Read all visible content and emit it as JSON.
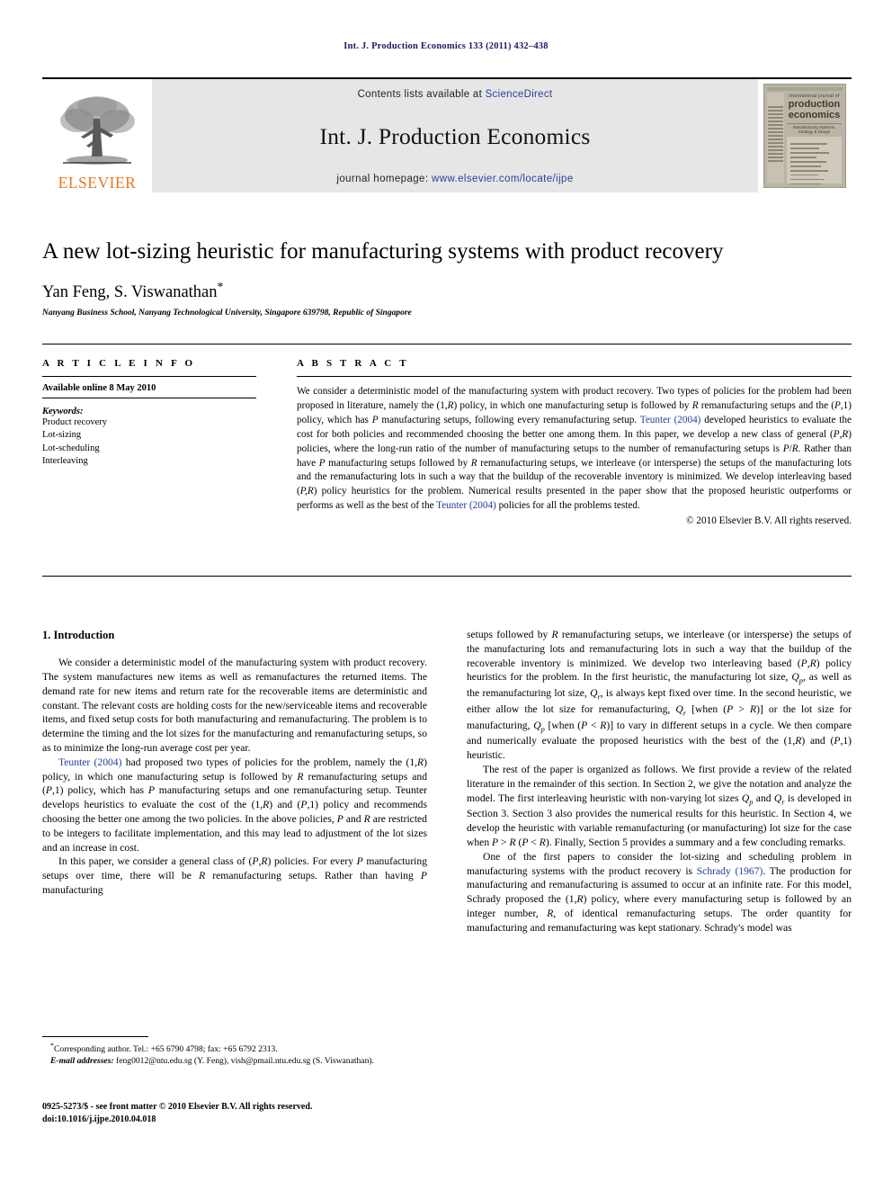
{
  "running_head": "Int. J. Production Economics 133 (2011) 432–438",
  "masthead": {
    "contents_prefix": "Contents lists available at ",
    "sciencedirect": "ScienceDirect",
    "journal_title": "Int. J. Production Economics",
    "homepage_prefix": "journal homepage: ",
    "homepage_url": "www.elsevier.com/locate/ijpe",
    "publisher_logo_text": "ELSEVIER",
    "cover": {
      "line1": "international journal of",
      "line2": "production",
      "line3": "economics",
      "line4": "Manufacturing Systems, Strategy & Design"
    },
    "colors": {
      "elsevier_orange": "#E87722",
      "link_blue": "#2b3f9c",
      "band_grey": "#e6e6e6"
    }
  },
  "article": {
    "title": "A new lot-sizing heuristic for manufacturing systems with product recovery",
    "authors": "Yan Feng, S. Viswanathan",
    "corresponding_marker": "*",
    "affiliation": "Nanyang Business School, Nanyang Technological University, Singapore 639798, Republic of Singapore"
  },
  "article_info": {
    "heading": "A R T I C L E   I N F O",
    "available_online": "Available online 8 May 2010",
    "keywords_label": "Keywords:",
    "keywords": [
      "Product recovery",
      "Lot-sizing",
      "Lot-scheduling",
      "Interleaving"
    ]
  },
  "abstract": {
    "heading": "A B S T R A C T",
    "p1_a": "We consider a deterministic model of the manufacturing system with product recovery. Two types of policies for the problem had been proposed in literature, namely the (1,",
    "p1_b": ") policy, in which one manufacturing setup is followed by ",
    "p1_c": " remanufacturing setups and the (",
    "p1_d": ",1) policy, which has ",
    "p1_e": " manufacturing setups, following every remanufacturing setup. ",
    "ref1": "Teunter (2004)",
    "p1_f": " developed heuristics to evaluate the cost for both policies and recommended choosing the better one among them. In this paper, we develop a new class of general (",
    "p1_g": ",",
    "p1_h": ") policies, where the long-run ratio of the number of manufacturing setups to the number of remanufacturing setups is ",
    "p1_i": "/",
    "p1_j": ". Rather than have ",
    "p1_k": " manufacturing setups followed by ",
    "p1_l": " remanufacturing setups, we interleave (or intersperse) the setups of the manufacturing lots and the remanufacturing lots in such a way that the buildup of the recoverable inventory is minimized. We develop interleaving based (",
    "p1_m": ") policy heuristics for the problem. Numerical results presented in the paper show that the proposed heuristic outperforms or performs as well as the best of the ",
    "ref2": "Teunter (2004)",
    "p1_n": " policies for all the problems tested.",
    "copyright": "© 2010 Elsevier B.V. All rights reserved."
  },
  "body": {
    "section_heading": "1.  Introduction",
    "left": {
      "p1": "We consider a deterministic model of the manufacturing system with product recovery. The system manufactures new items as well as remanufactures the returned items. The demand rate for new items and return rate for the recoverable items are deterministic and constant. The relevant costs are holding costs for the new/serviceable items and recoverable items, and fixed setup costs for both manufacturing and remanufacturing. The problem is to determine the timing and the lot sizes for the manufacturing and remanufacturing setups, so as to minimize the long-run average cost per year.",
      "p2_ref": "Teunter (2004)",
      "p2_a": " had proposed two types of policies for the problem, namely the (1,",
      "p2_b": ") policy, in which one manufacturing setup is followed by ",
      "p2_c": " remanufacturing setups and (",
      "p2_d": ",1) policy, which has ",
      "p2_e": " manufacturing setups and one remanufacturing setup. Teunter develops heuristics to evaluate the cost of the (1,",
      "p2_f": ") and (",
      "p2_g": ",1) policy and recommends choosing the better one among the two policies. In the above policies, ",
      "p2_h": " and ",
      "p2_i": " are restricted to be integers to facilitate implementation, and this may lead to adjustment of the lot sizes and an increase in cost.",
      "p3_a": "In this paper, we consider a general class of (",
      "p3_b": ",",
      "p3_c": ") policies. For every ",
      "p3_d": " manufacturing setups over time, there will be ",
      "p3_e": " remanufacturing setups. Rather than having ",
      "p3_f": " manufacturing"
    },
    "right": {
      "p1_a": "setups followed by ",
      "p1_b": " remanufacturing setups, we interleave (or intersperse) the setups of the manufacturing lots and remanufacturing lots in such a way that the buildup of the recoverable inventory is minimized. We develop two interleaving based (",
      "p1_c": ",",
      "p1_d": ") policy heuristics for the problem. In the first heuristic, the manufacturing lot size, ",
      "p1_e": ", as well as the remanufacturing lot size, ",
      "p1_f": ", is always kept fixed over time. In the second heuristic, we either allow the lot size for remanufacturing, ",
      "p1_g": " [when (",
      "p1_h": " > ",
      "p1_i": ")] or the lot size for manufacturing, ",
      "p1_j": " [when (",
      "p1_k": " < ",
      "p1_l": ")] to vary in different setups in a cycle. We then compare and numerically evaluate the proposed heuristics with the best of the (1,",
      "p1_m": ") and (",
      "p1_n": ",1) heuristic.",
      "p2_a": "The rest of the paper is organized as follows. We first provide a review of the related literature in the remainder of this section. In Section 2, we give the notation and analyze the model. The first interleaving heuristic with non-varying lot sizes ",
      "p2_b": " and ",
      "p2_c": " is developed in Section 3. Section 3 also provides the numerical results for this heuristic. In Section 4, we develop the heuristic with variable remanufacturing (or manufacturing) lot size for the case when ",
      "p2_d": " > ",
      "p2_e": " (",
      "p2_f": " < ",
      "p2_g": "). Finally, Section 5 provides a summary and a few concluding remarks.",
      "p3_a": "One of the first papers to consider the lot-sizing and scheduling problem in manufacturing systems with the product recovery is ",
      "p3_ref": "Schrady (1967)",
      "p3_b": ". The production for manufacturing and remanufacturing is assumed to occur at an infinite rate. For this model, Schrady proposed the (1,",
      "p3_c": ") policy, where every manufacturing setup is followed by an integer number, ",
      "p3_d": ", of identical remanufacturing setups. The order quantity for manufacturing and remanufacturing was kept stationary. Schrady's model was"
    }
  },
  "footnotes": {
    "corresponding": "Corresponding author. Tel.: +65 6790 4798; fax: +65 6792 2313.",
    "email_label": "E-mail addresses:",
    "emails": " feng0012@ntu.edu.sg (Y. Feng), vish@pmail.ntu.edu.sg (S. Viswanathan).",
    "imprint_line1": "0925-5273/$ - see front matter © 2010 Elsevier B.V. All rights reserved.",
    "imprint_line2": "doi:10.1016/j.ijpe.2010.04.018"
  },
  "symbols": {
    "P": "P",
    "R": "R",
    "Qp_base": "Q",
    "Qp_sub": "p",
    "Qr_sub": "r",
    "PR_pair": "P,R"
  }
}
